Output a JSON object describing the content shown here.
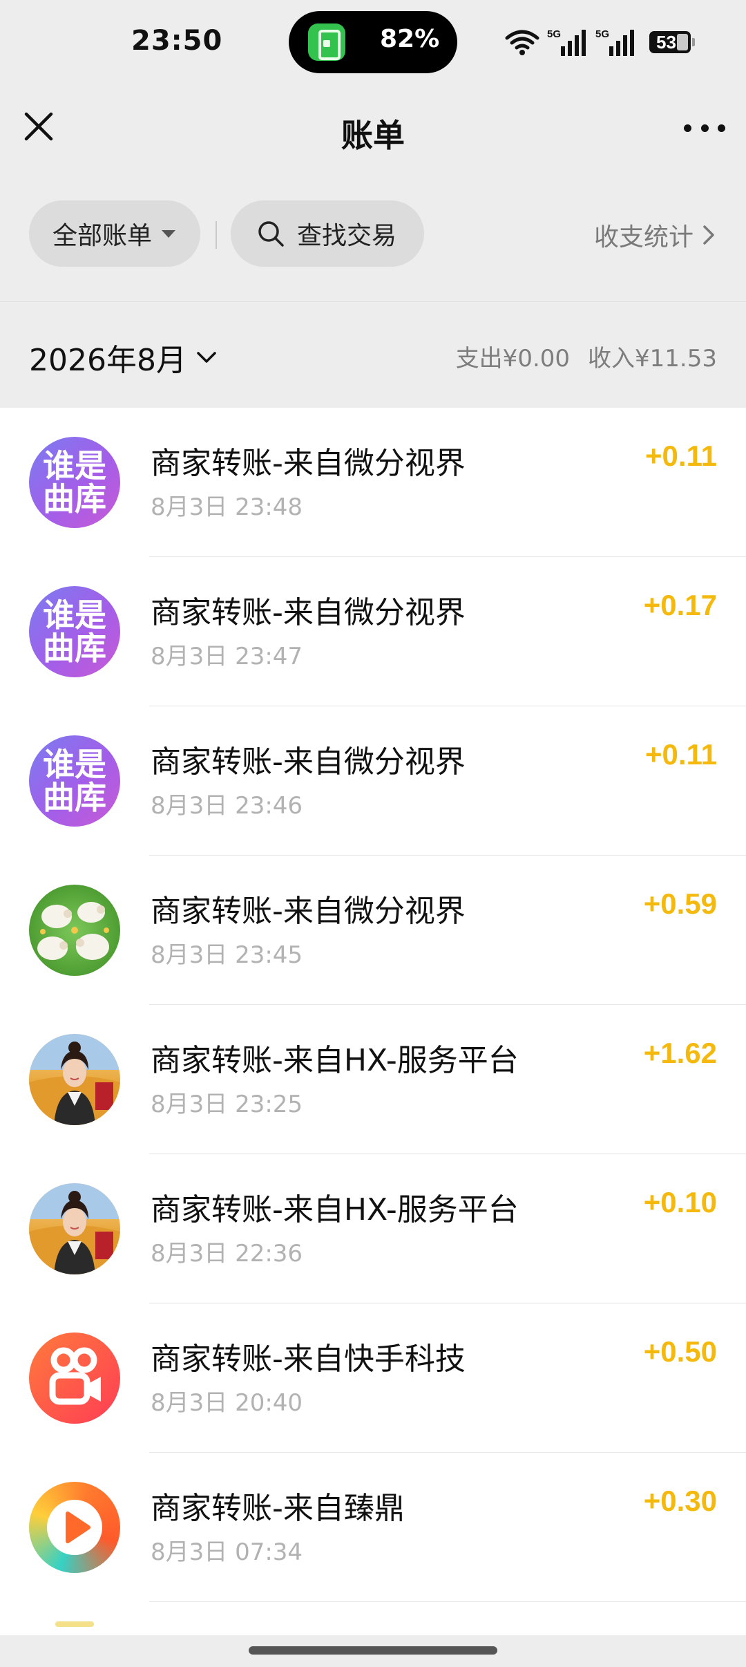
{
  "status_bar": {
    "time": "23:50",
    "battery_pill_text": "82%",
    "network_labels": [
      "5G",
      "5G"
    ],
    "battery_level": "53"
  },
  "nav": {
    "title": "账单",
    "close_icon": "close-icon",
    "more_icon": "more-dots-icon"
  },
  "filters": {
    "all_bills_label": "全部账单",
    "search_label": "查找交易",
    "stats_label": "收支统计"
  },
  "month_header": {
    "month": "2026年8月",
    "expense": "支出¥0.00",
    "income": "收入¥11.53"
  },
  "colors": {
    "income_amount": "#f5b90e",
    "background": "#ededed",
    "list_background": "#ffffff"
  },
  "transactions": [
    {
      "title": "商家转账-来自微分视界",
      "time": "8月3日 23:48",
      "amount": "+0.11",
      "avatar": "purple-text-avatar",
      "avatar_text": [
        "谁是",
        "曲库"
      ]
    },
    {
      "title": "商家转账-来自微分视界",
      "time": "8月3日 23:47",
      "amount": "+0.17",
      "avatar": "purple-text-avatar",
      "avatar_text": [
        "谁是",
        "曲库"
      ]
    },
    {
      "title": "商家转账-来自微分视界",
      "time": "8月3日 23:46",
      "amount": "+0.11",
      "avatar": "purple-text-avatar",
      "avatar_text": [
        "谁是",
        "曲库"
      ]
    },
    {
      "title": "商家转账-来自微分视界",
      "time": "8月3日 23:45",
      "amount": "+0.59",
      "avatar": "sheep-avatar"
    },
    {
      "title": "商家转账-来自HX-服务平台",
      "time": "8月3日 23:25",
      "amount": "+1.62",
      "avatar": "woman-avatar"
    },
    {
      "title": "商家转账-来自HX-服务平台",
      "time": "8月3日 22:36",
      "amount": "+0.10",
      "avatar": "woman-avatar"
    },
    {
      "title": "商家转账-来自快手科技",
      "time": "8月3日 20:40",
      "amount": "+0.50",
      "avatar": "kuaishou-logo-avatar"
    },
    {
      "title": "商家转账-来自臻鼎",
      "time": "8月3日 07:34",
      "amount": "+0.30",
      "avatar": "play-logo-avatar"
    }
  ]
}
